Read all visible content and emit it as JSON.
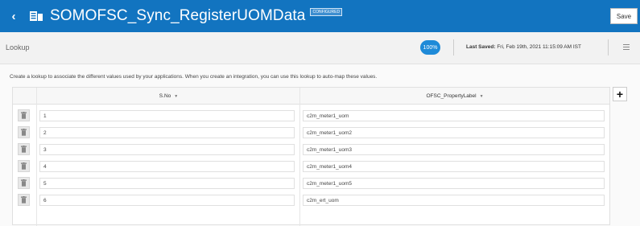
{
  "header": {
    "back_icon": "chevron-left-icon",
    "lookup_icon": "lookup-table-icon",
    "title": "SOMOFSC_Sync_RegisterUOMData",
    "status_badge": "CONFIGURED",
    "save_label": "Save",
    "brand_color": "#1274c0"
  },
  "subheader": {
    "title": "Lookup",
    "progress": "100%",
    "last_saved_label": "Last Saved:",
    "last_saved_value": "Fri, Feb 19th, 2021 11:15:09 AM IST",
    "menu_icon": "hamburger-menu-icon"
  },
  "description": "Create a lookup to associate the different values used by your applications. When you create an integration, you can use this lookup to auto-map these values.",
  "table": {
    "add_icon": "plus-icon",
    "delete_icon": "trash-icon",
    "columns": [
      {
        "label": "S.No",
        "sort_icon": "caret-down-icon"
      },
      {
        "label": "OFSC_PropertyLabel",
        "sort_icon": "caret-down-icon"
      }
    ],
    "rows": [
      {
        "sno": "1",
        "label": "c2m_meter1_uom"
      },
      {
        "sno": "2",
        "label": "c2m_meter1_uom2"
      },
      {
        "sno": "3",
        "label": "c2m_meter1_uom3"
      },
      {
        "sno": "4",
        "label": "c2m_meter1_uom4"
      },
      {
        "sno": "5",
        "label": "c2m_meter1_uom5"
      },
      {
        "sno": "6",
        "label": "c2m_ert_uom"
      }
    ]
  }
}
